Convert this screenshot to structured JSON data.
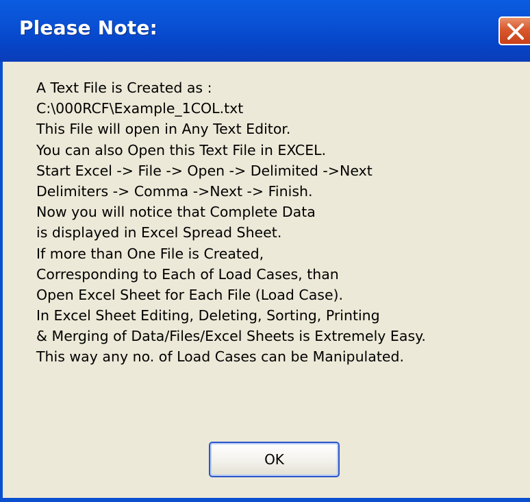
{
  "window": {
    "title": "Please Note:",
    "close_icon": "close-icon"
  },
  "message": {
    "lines": [
      "A Text File is Created as :",
      "C:\\000RCF\\Example_1COL.txt",
      "This File will open in Any Text Editor.",
      "You can also Open this Text File in EXCEL.",
      "Start Excel -> File -> Open -> Delimited ->Next",
      "Delimiters -> Comma ->Next -> Finish.",
      "Now you will notice that Complete Data",
      "is displayed in Excel Spread Sheet.",
      "If more than One File is Created,",
      "Corresponding to Each of Load Cases, than",
      "Open Excel Sheet for Each File (Load Case).",
      "In Excel Sheet Editing, Deleting, Sorting, Printing",
      "& Merging of Data/Files/Excel Sheets is Extremely Easy.",
      "This way any no. of Load Cases can be Manipulated."
    ]
  },
  "buttons": {
    "ok_label": "OK"
  },
  "colors": {
    "titlebar": "#0a52d6",
    "dialog_background": "#ece9d8",
    "close_button": "#d9582c",
    "ok_button_border": "#2c55c9"
  }
}
